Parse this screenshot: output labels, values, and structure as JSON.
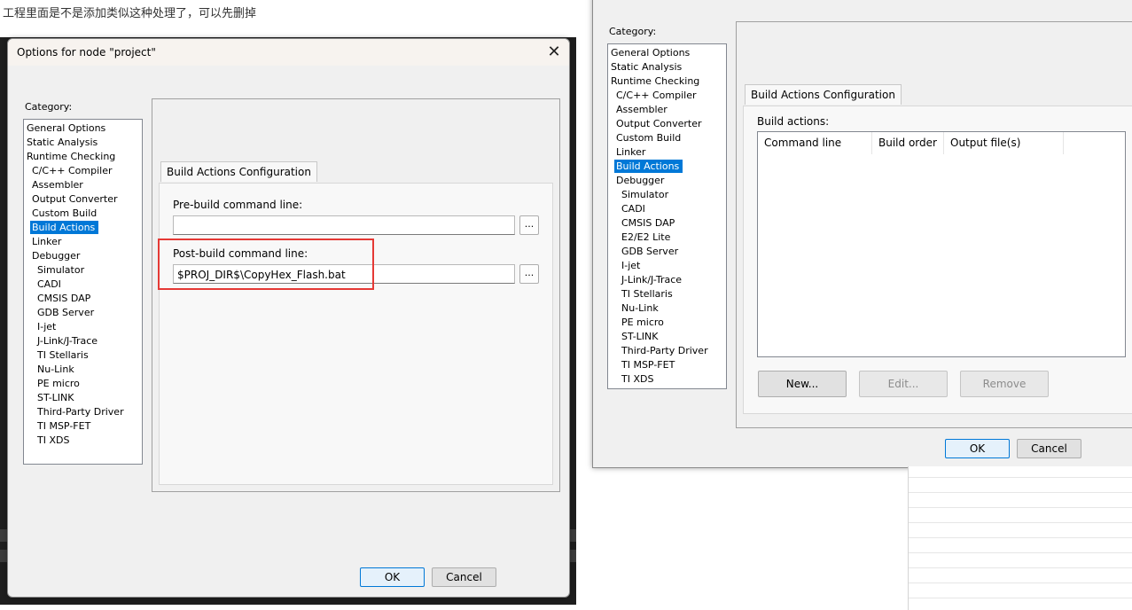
{
  "page_caption": "工程里面是不是添加类似这种处理了，可以先删掉",
  "left_dialog": {
    "title": "Options for node \"project\"",
    "close_glyph": "✕",
    "category_label": "Category:",
    "categories": [
      {
        "label": "General Options",
        "indent": 0
      },
      {
        "label": "Static Analysis",
        "indent": 0
      },
      {
        "label": "Runtime Checking",
        "indent": 0
      },
      {
        "label": "C/C++ Compiler",
        "indent": 1
      },
      {
        "label": "Assembler",
        "indent": 1
      },
      {
        "label": "Output Converter",
        "indent": 1
      },
      {
        "label": "Custom Build",
        "indent": 1
      },
      {
        "label": "Build Actions",
        "indent": 1,
        "selected": true
      },
      {
        "label": "Linker",
        "indent": 1
      },
      {
        "label": "Debugger",
        "indent": 1
      },
      {
        "label": "Simulator",
        "indent": 2
      },
      {
        "label": "CADI",
        "indent": 2
      },
      {
        "label": "CMSIS DAP",
        "indent": 2
      },
      {
        "label": "GDB Server",
        "indent": 2
      },
      {
        "label": "I-jet",
        "indent": 2
      },
      {
        "label": "J-Link/J-Trace",
        "indent": 2
      },
      {
        "label": "TI Stellaris",
        "indent": 2
      },
      {
        "label": "Nu-Link",
        "indent": 2
      },
      {
        "label": "PE micro",
        "indent": 2
      },
      {
        "label": "ST-LINK",
        "indent": 2
      },
      {
        "label": "Third-Party Driver",
        "indent": 2
      },
      {
        "label": "TI MSP-FET",
        "indent": 2
      },
      {
        "label": "TI XDS",
        "indent": 2
      }
    ],
    "tab_label": "Build Actions Configuration",
    "prebuild_label": "Pre-build command line:",
    "prebuild_value": "",
    "postbuild_label": "Post-build command line:",
    "postbuild_value": "$PROJ_DIR$\\CopyHex_Flash.bat",
    "browse_label": "...",
    "ok_label": "OK",
    "cancel_label": "Cancel",
    "highlight_color": "#e53935"
  },
  "right_dialog": {
    "category_label": "Category:",
    "categories": [
      {
        "label": "General Options",
        "indent": 0
      },
      {
        "label": "Static Analysis",
        "indent": 0
      },
      {
        "label": "Runtime Checking",
        "indent": 0
      },
      {
        "label": "C/C++ Compiler",
        "indent": 1
      },
      {
        "label": "Assembler",
        "indent": 1
      },
      {
        "label": "Output Converter",
        "indent": 1
      },
      {
        "label": "Custom Build",
        "indent": 1
      },
      {
        "label": "Linker",
        "indent": 1
      },
      {
        "label": "Build Actions",
        "indent": 1,
        "selected": true
      },
      {
        "label": "Debugger",
        "indent": 1
      },
      {
        "label": "Simulator",
        "indent": 2
      },
      {
        "label": "CADI",
        "indent": 2
      },
      {
        "label": "CMSIS DAP",
        "indent": 2
      },
      {
        "label": "E2/E2 Lite",
        "indent": 2
      },
      {
        "label": "GDB Server",
        "indent": 2
      },
      {
        "label": "I-jet",
        "indent": 2
      },
      {
        "label": "J-Link/J-Trace",
        "indent": 2
      },
      {
        "label": "TI Stellaris",
        "indent": 2
      },
      {
        "label": "Nu-Link",
        "indent": 2
      },
      {
        "label": "PE micro",
        "indent": 2
      },
      {
        "label": "ST-LINK",
        "indent": 2
      },
      {
        "label": "Third-Party Driver",
        "indent": 2
      },
      {
        "label": "TI MSP-FET",
        "indent": 2
      },
      {
        "label": "TI XDS",
        "indent": 2
      }
    ],
    "tab_label": "Build Actions Configuration",
    "build_actions_label": "Build actions:",
    "columns": [
      "Command line",
      "Build order",
      "Output file(s)"
    ],
    "new_label": "New...",
    "edit_label": "Edit...",
    "remove_label": "Remove",
    "ok_label": "OK",
    "cancel_label": "Cancel"
  },
  "colors": {
    "selection": "#0078d7",
    "editor_bg": "#1e1e1e",
    "editor_text": "#4fc1ff"
  }
}
